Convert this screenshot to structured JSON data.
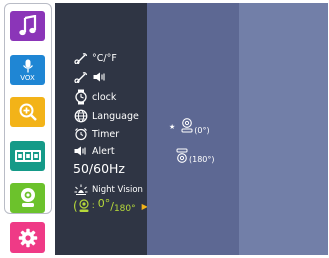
{
  "colors": {
    "rail_music": "#8b35b8",
    "rail_vox": "#1f86d4",
    "rail_zoom": "#f3b318",
    "rail_display": "#159a88",
    "rail_camera": "#6cc22c",
    "rail_settings": "#ef3a86",
    "menu_bg": "#2f3544",
    "option_bg": "#5d6893",
    "right_bg": "#727fa8",
    "highlight": "#b6d93a"
  },
  "rail": {
    "music_icon": "music-note",
    "vox_label": "VOX",
    "zoom_icon": "zoom-in",
    "display_icon": "display-book",
    "camera_icon": "baby-camera",
    "settings_icon": "gear"
  },
  "menu": {
    "temp_unit": "°C/°F",
    "temp_alert_icon": "speaker",
    "clock": "clock",
    "language": "Language",
    "timer": "Timer",
    "alert": "Alert",
    "frequency": "50/60Hz",
    "night_vision": "Night Vision",
    "rotation_a": "0°",
    "rotation_sep": "/",
    "rotation_b": "180°"
  },
  "options": {
    "selected_marker": "★",
    "option_0": "(0°)",
    "option_180": "(180°)"
  }
}
